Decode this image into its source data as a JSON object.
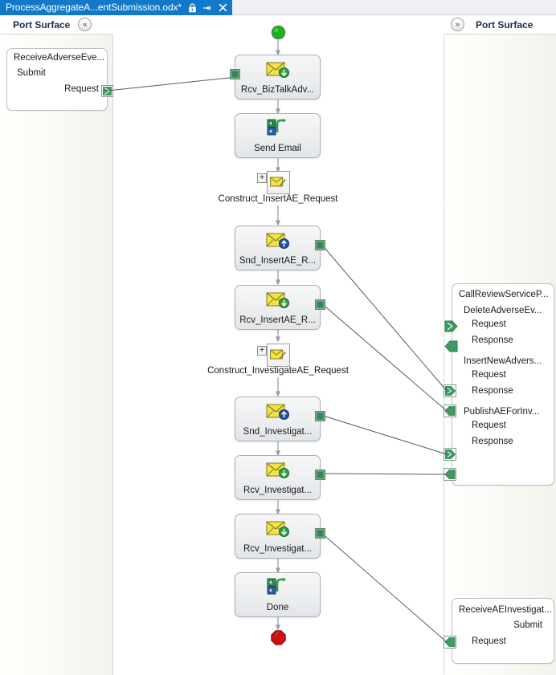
{
  "window": {
    "tab": {
      "title": "ProcessAggregateA...entSubmission.odx*",
      "icons": [
        "lock-icon",
        "pin-icon",
        "close-icon"
      ]
    }
  },
  "left_panel": {
    "header": {
      "label": "Port Surface",
      "collapse_icon": "chevron-double-left-icon",
      "chevron": "«"
    },
    "ports": [
      {
        "title": "ReceiveAdverseEve...",
        "operation": "Submit",
        "messages": [
          {
            "label": "Request",
            "direction": "out",
            "connected": true
          }
        ]
      }
    ]
  },
  "right_panel": {
    "header": {
      "label": "Port Surface",
      "collapse_icon": "chevron-double-right-icon",
      "chevron": "»"
    },
    "ports": [
      {
        "title": "CallReviewServiceP...",
        "operations": [
          {
            "name": "DeleteAdverseEv...",
            "messages": [
              {
                "label": "Request",
                "direction": "in",
                "connected": false
              },
              {
                "label": "Response",
                "direction": "out",
                "connected": false
              }
            ]
          },
          {
            "name": "InsertNewAdvers...",
            "messages": [
              {
                "label": "Request",
                "direction": "in",
                "connected": true
              },
              {
                "label": "Response",
                "direction": "out",
                "connected": true
              }
            ]
          },
          {
            "name": "PublishAEForInv...",
            "messages": [
              {
                "label": "Request",
                "direction": "in",
                "connected": true
              },
              {
                "label": "Response",
                "direction": "out",
                "connected": true
              }
            ]
          }
        ]
      },
      {
        "title": "ReceiveAEInvestigat...",
        "operation": "Submit",
        "messages": [
          {
            "label": "Request",
            "direction": "out",
            "connected": true
          }
        ]
      }
    ]
  },
  "canvas": {
    "begin_marker": "begin-shape-green-circle",
    "end_marker": "end-shape-red-octagon",
    "shapes": [
      {
        "label": "Rcv_BizTalkAdv...",
        "icon": "receive-shape-icon",
        "port_side": "left"
      },
      {
        "label": "Send Email",
        "icon": "call-orchestration-icon",
        "port_side": "none"
      },
      {
        "label": "Snd_InsertAE_R...",
        "icon": "send-shape-icon",
        "port_side": "right"
      },
      {
        "label": "Rcv_InsertAE_R...",
        "icon": "receive-shape-icon",
        "port_side": "right"
      },
      {
        "label": "Snd_Investigat...",
        "icon": "send-shape-icon",
        "port_side": "right"
      },
      {
        "label": "Rcv_Investigat...",
        "icon": "receive-shape-icon",
        "port_side": "right"
      },
      {
        "label": "Rcv_Investigat...",
        "icon": "receive-shape-icon",
        "port_side": "right"
      },
      {
        "label": "Done",
        "icon": "call-orchestration-icon",
        "port_side": "none"
      }
    ],
    "constructs": [
      {
        "label": "Construct_InsertAE_Request",
        "icon": "construct-message-icon",
        "expander": "+"
      },
      {
        "label": "Construct_InvestigateAE_Request",
        "icon": "construct-message-icon",
        "expander": "+"
      }
    ]
  },
  "colors": {
    "tab_active": "#1279c8",
    "connector_green": "#3d9b62",
    "begin_green": "#17b517",
    "end_red": "#cc1111",
    "envelope_yellow": "#f2e34c",
    "shape_border": "#a9b0b6"
  }
}
